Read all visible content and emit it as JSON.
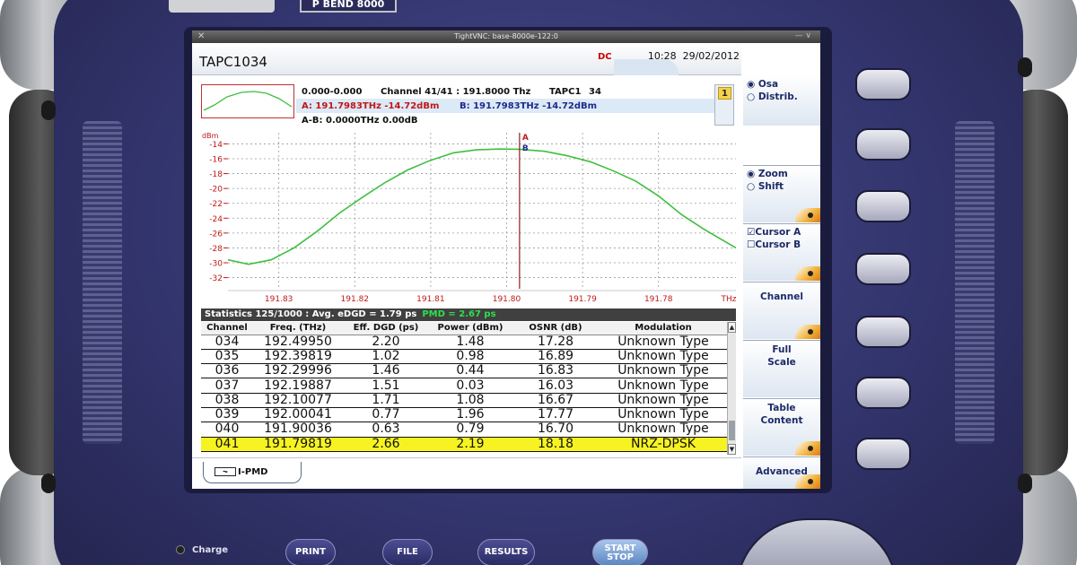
{
  "device": {
    "badge_label": "P BEND 8000",
    "charge_label": "Charge",
    "buttons": {
      "print": "PRINT",
      "file": "FILE",
      "results": "RESULTS",
      "start_line1": "START",
      "start_line2": "STOP"
    }
  },
  "vnc": {
    "title": "TightVNC: base-8000e-122:0",
    "close_glyph": "✕",
    "controls": "— ∨"
  },
  "window": {
    "title": "TAPC1034",
    "time": "10:28",
    "date": "29/02/2012",
    "logo": "DC"
  },
  "info": {
    "range": "0.000-0.000",
    "channel": "Channel 41/41 : 191.8000 Thz",
    "trace": "TAPC1",
    "trace_num": "34",
    "cursor_a": "A: 191.7983THz -14.72dBm",
    "cursor_b": "B: 191.7983THz -14.72dBm",
    "delta": "A-B: 0.0000THz  0.00dB",
    "page": "1"
  },
  "chart_data": {
    "type": "line",
    "ylabel": "dBm",
    "xlabel": "THz",
    "y_ticks": [
      "-14",
      "-16",
      "-18",
      "-20",
      "-22",
      "-24",
      "-26",
      "-28",
      "-30",
      "-32"
    ],
    "x_ticks": [
      "191.83",
      "191.82",
      "191.81",
      "191.80",
      "191.79",
      "191.78",
      "THz"
    ],
    "xlim": [
      191.8367,
      191.7698
    ],
    "ylim": [
      -33.5,
      -12.5
    ],
    "grid": true,
    "cursor_x": 191.7983,
    "cursor_labels": [
      "A",
      "B"
    ],
    "series": [
      {
        "color": "#3fbf3f",
        "x": [
          191.8367,
          191.834,
          191.831,
          191.828,
          191.825,
          191.822,
          191.819,
          191.816,
          191.813,
          191.81,
          191.807,
          191.804,
          191.801,
          191.7983,
          191.795,
          191.792,
          191.789,
          191.786,
          191.783,
          191.78,
          191.777,
          191.774,
          191.7698
        ],
        "y": [
          -29.6,
          -30.2,
          -29.6,
          -28.0,
          -25.8,
          -23.3,
          -21.2,
          -19.2,
          -17.5,
          -16.2,
          -15.2,
          -14.8,
          -14.7,
          -14.72,
          -15.0,
          -15.6,
          -16.4,
          -17.6,
          -19.0,
          -21.0,
          -23.5,
          -25.5,
          -28.0
        ]
      }
    ]
  },
  "stats": {
    "text": "Statistics 125/1000 : Avg. eDGD = 1.79 ps",
    "pmd": "PMD = 2.67 ps"
  },
  "table": {
    "headers": [
      "Channel",
      "Freq. (THz)",
      "Eff. DGD (ps)",
      "Power (dBm)",
      "OSNR (dB)",
      "Modulation"
    ],
    "rows": [
      [
        "034",
        "192.49950",
        "2.20",
        "1.48",
        "17.28",
        "Unknown Type"
      ],
      [
        "035",
        "192.39819",
        "1.02",
        "0.98",
        "16.89",
        "Unknown Type"
      ],
      [
        "036",
        "192.29996",
        "1.46",
        "0.44",
        "16.83",
        "Unknown Type"
      ],
      [
        "037",
        "192.19887",
        "1.51",
        "0.03",
        "16.03",
        "Unknown Type"
      ],
      [
        "038",
        "192.10077",
        "1.71",
        "1.08",
        "16.67",
        "Unknown Type"
      ],
      [
        "039",
        "192.00041",
        "0.77",
        "1.96",
        "17.77",
        "Unknown Type"
      ],
      [
        "040",
        "191.90036",
        "0.63",
        "0.79",
        "16.70",
        "Unknown Type"
      ],
      [
        "041",
        "191.79819",
        "2.66",
        "2.19",
        "18.18",
        "NRZ-DPSK"
      ]
    ],
    "selected_row": 7
  },
  "tab": {
    "label": "I-PMD"
  },
  "sidemenu": {
    "osa": "Osa",
    "distrib": "Distrib.",
    "zoom": "Zoom",
    "shift": "Shift",
    "cursor_a": "Cursor A",
    "cursor_b": "Cursor B",
    "channel": "Channel",
    "full_scale_1": "Full",
    "full_scale_2": "Scale",
    "table_content_1": "Table",
    "table_content_2": "Content",
    "advanced": "Advanced"
  }
}
